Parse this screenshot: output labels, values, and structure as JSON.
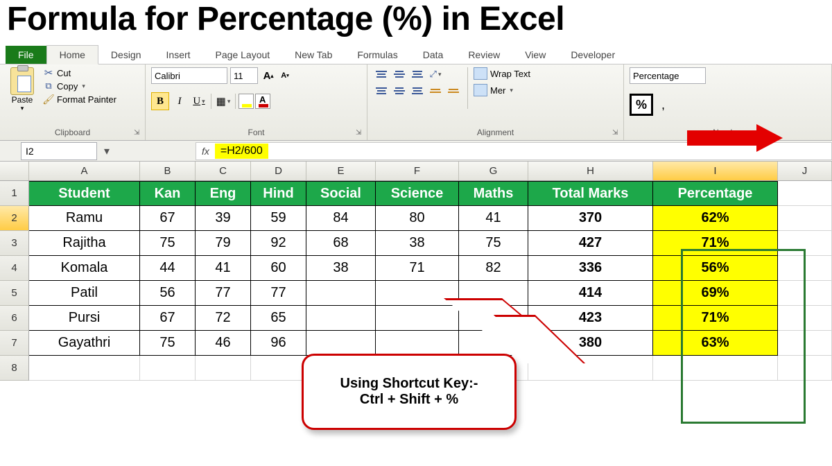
{
  "title": "Formula for Percentage (%) in Excel",
  "tabs": {
    "file": "File",
    "home": "Home",
    "design": "Design",
    "insert": "Insert",
    "pageLayout": "Page Layout",
    "newTab": "New Tab",
    "formulas": "Formulas",
    "data": "Data",
    "review": "Review",
    "view": "View",
    "developer": "Developer"
  },
  "clipboard": {
    "paste": "Paste",
    "cut": "Cut",
    "copy": "Copy",
    "formatPainter": "Format Painter",
    "groupLabel": "Clipboard"
  },
  "font": {
    "name": "Calibri",
    "size": "11",
    "groupLabel": "Font",
    "bold": "B",
    "italic": "I",
    "underline": "U"
  },
  "alignment": {
    "wrap": "Wrap Text",
    "merge": "Mer",
    "groupLabel": "Alignment"
  },
  "number": {
    "format": "Percentage",
    "groupLabel": "Number",
    "pct": "%",
    "comma": ","
  },
  "formulaBar": {
    "nameBox": "I2",
    "fx": "fx",
    "formula": "=H2/600"
  },
  "columns": {
    "A": "A",
    "B": "B",
    "C": "C",
    "D": "D",
    "E": "E",
    "F": "F",
    "G": "G",
    "H": "H",
    "I": "I",
    "J": "J"
  },
  "rowNums": [
    "1",
    "2",
    "3",
    "4",
    "5",
    "6",
    "7",
    "8"
  ],
  "headers": {
    "student": "Student",
    "kan": "Kan",
    "eng": "Eng",
    "hind": "Hind",
    "social": "Social",
    "science": "Science",
    "maths": "Maths",
    "total": "Total Marks",
    "pct": "Percentage"
  },
  "rows": [
    {
      "student": "Ramu",
      "kan": "67",
      "eng": "39",
      "hind": "59",
      "social": "84",
      "science": "80",
      "maths": "41",
      "total": "370",
      "pct": "62%"
    },
    {
      "student": "Rajitha",
      "kan": "75",
      "eng": "79",
      "hind": "92",
      "social": "68",
      "science": "38",
      "maths": "75",
      "total": "427",
      "pct": "71%"
    },
    {
      "student": "Komala",
      "kan": "44",
      "eng": "41",
      "hind": "60",
      "social": "38",
      "science": "71",
      "maths": "82",
      "total": "336",
      "pct": "56%"
    },
    {
      "student": "Patil",
      "kan": "56",
      "eng": "77",
      "hind": "77",
      "social": "",
      "science": "",
      "maths": "",
      "total": "414",
      "pct": "69%"
    },
    {
      "student": "Pursi",
      "kan": "67",
      "eng": "72",
      "hind": "65",
      "social": "",
      "science": "",
      "maths": "",
      "total": "423",
      "pct": "71%"
    },
    {
      "student": "Gayathri",
      "kan": "75",
      "eng": "46",
      "hind": "96",
      "social": "",
      "science": "",
      "maths": "",
      "total": "380",
      "pct": "63%"
    }
  ],
  "callout": {
    "line1": "Using Shortcut Key:-",
    "line2": "Ctrl + Shift + %"
  }
}
